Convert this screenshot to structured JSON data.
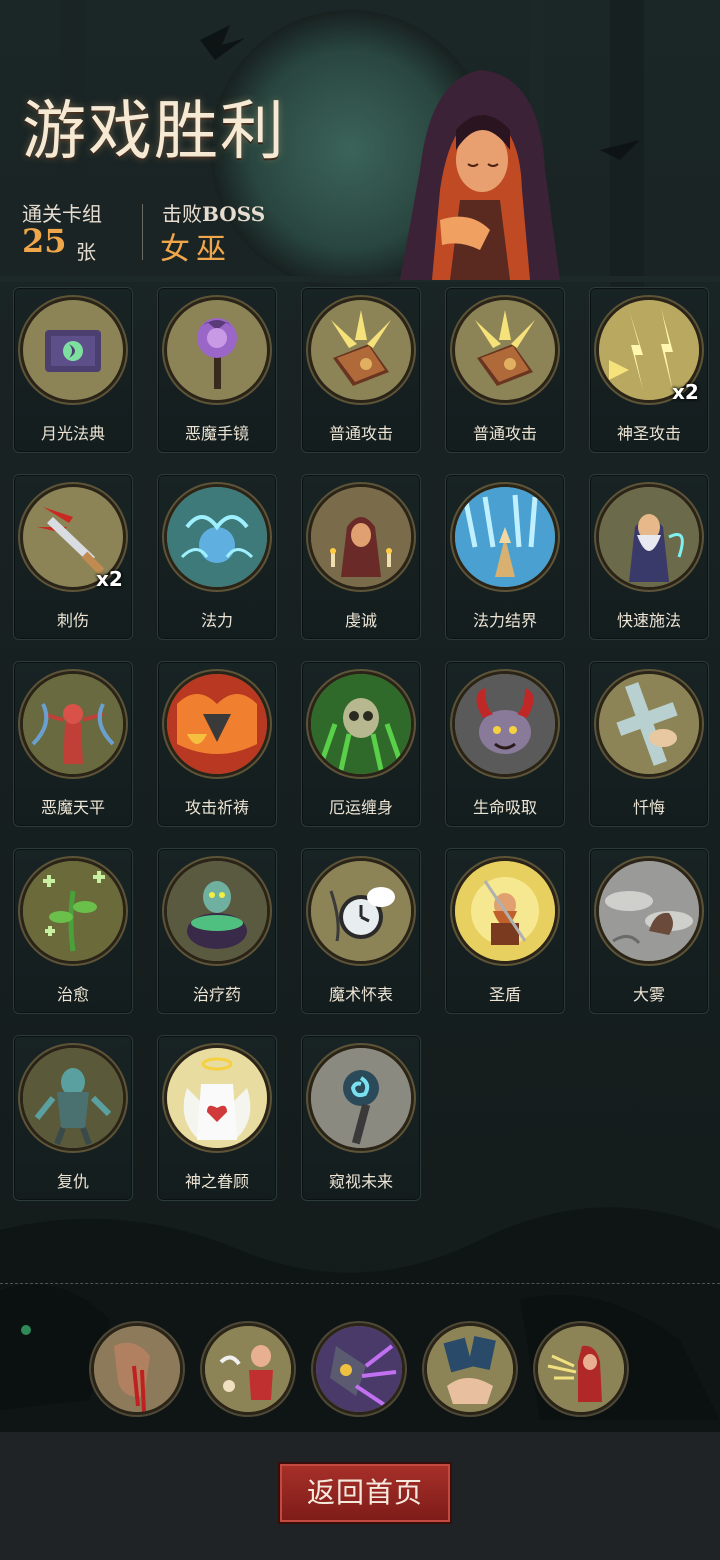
{
  "header": {
    "title": "游戏胜利",
    "deck_label": "通关卡组",
    "deck_count": "25",
    "deck_unit": "张",
    "boss_label_prefix": "击败",
    "boss_label_suffix": "BOSS",
    "boss_name": "女巫"
  },
  "cards": [
    {
      "name": "月光法典",
      "icon": "moonlight-tome-icon",
      "multiplier": ""
    },
    {
      "name": "恶魔手镜",
      "icon": "demon-mirror-icon",
      "multiplier": ""
    },
    {
      "name": "普通攻击",
      "icon": "spellbook-strike-icon",
      "multiplier": ""
    },
    {
      "name": "普通攻击",
      "icon": "spellbook-strike-icon",
      "multiplier": ""
    },
    {
      "name": "神圣攻击",
      "icon": "holy-lightning-icon",
      "multiplier": "x2"
    },
    {
      "name": "刺伤",
      "icon": "dagger-stab-icon",
      "multiplier": "x2"
    },
    {
      "name": "法力",
      "icon": "mana-orb-icon",
      "multiplier": ""
    },
    {
      "name": "虔诚",
      "icon": "praying-monk-icon",
      "multiplier": ""
    },
    {
      "name": "法力结界",
      "icon": "mana-barrier-icon",
      "multiplier": ""
    },
    {
      "name": "快速施法",
      "icon": "wizard-cast-icon",
      "multiplier": ""
    },
    {
      "name": "恶魔天平",
      "icon": "demon-scale-icon",
      "multiplier": ""
    },
    {
      "name": "攻击祈祷",
      "icon": "fiery-prayer-icon",
      "multiplier": ""
    },
    {
      "name": "厄运缠身",
      "icon": "cursed-skull-icon",
      "multiplier": ""
    },
    {
      "name": "生命吸取",
      "icon": "horned-demon-icon",
      "multiplier": ""
    },
    {
      "name": "忏悔",
      "icon": "holy-cross-icon",
      "multiplier": ""
    },
    {
      "name": "治愈",
      "icon": "healing-plant-icon",
      "multiplier": ""
    },
    {
      "name": "治疗药",
      "icon": "potion-cauldron-icon",
      "multiplier": ""
    },
    {
      "name": "魔术怀表",
      "icon": "pocket-watch-icon",
      "multiplier": ""
    },
    {
      "name": "圣盾",
      "icon": "holy-shield-dwarf-icon",
      "multiplier": ""
    },
    {
      "name": "大雾",
      "icon": "fog-beast-icon",
      "multiplier": ""
    },
    {
      "name": "复仇",
      "icon": "zombie-avenger-icon",
      "multiplier": ""
    },
    {
      "name": "神之眷顾",
      "icon": "angel-heart-icon",
      "multiplier": ""
    },
    {
      "name": "窥视未来",
      "icon": "seer-staff-icon",
      "multiplier": ""
    }
  ],
  "relics": [
    {
      "icon": "bleeding-hand-icon"
    },
    {
      "icon": "bard-girl-icon"
    },
    {
      "icon": "arcane-gauntlet-icon"
    },
    {
      "icon": "card-hand-icon"
    },
    {
      "icon": "red-hood-mage-icon"
    }
  ],
  "footer": {
    "home_button": "返回首页"
  },
  "colors": {
    "accent_orange": "#f0a64a",
    "button_red": "#9a2a25",
    "card_ring": "#8c8457",
    "background": "#141b1c"
  }
}
